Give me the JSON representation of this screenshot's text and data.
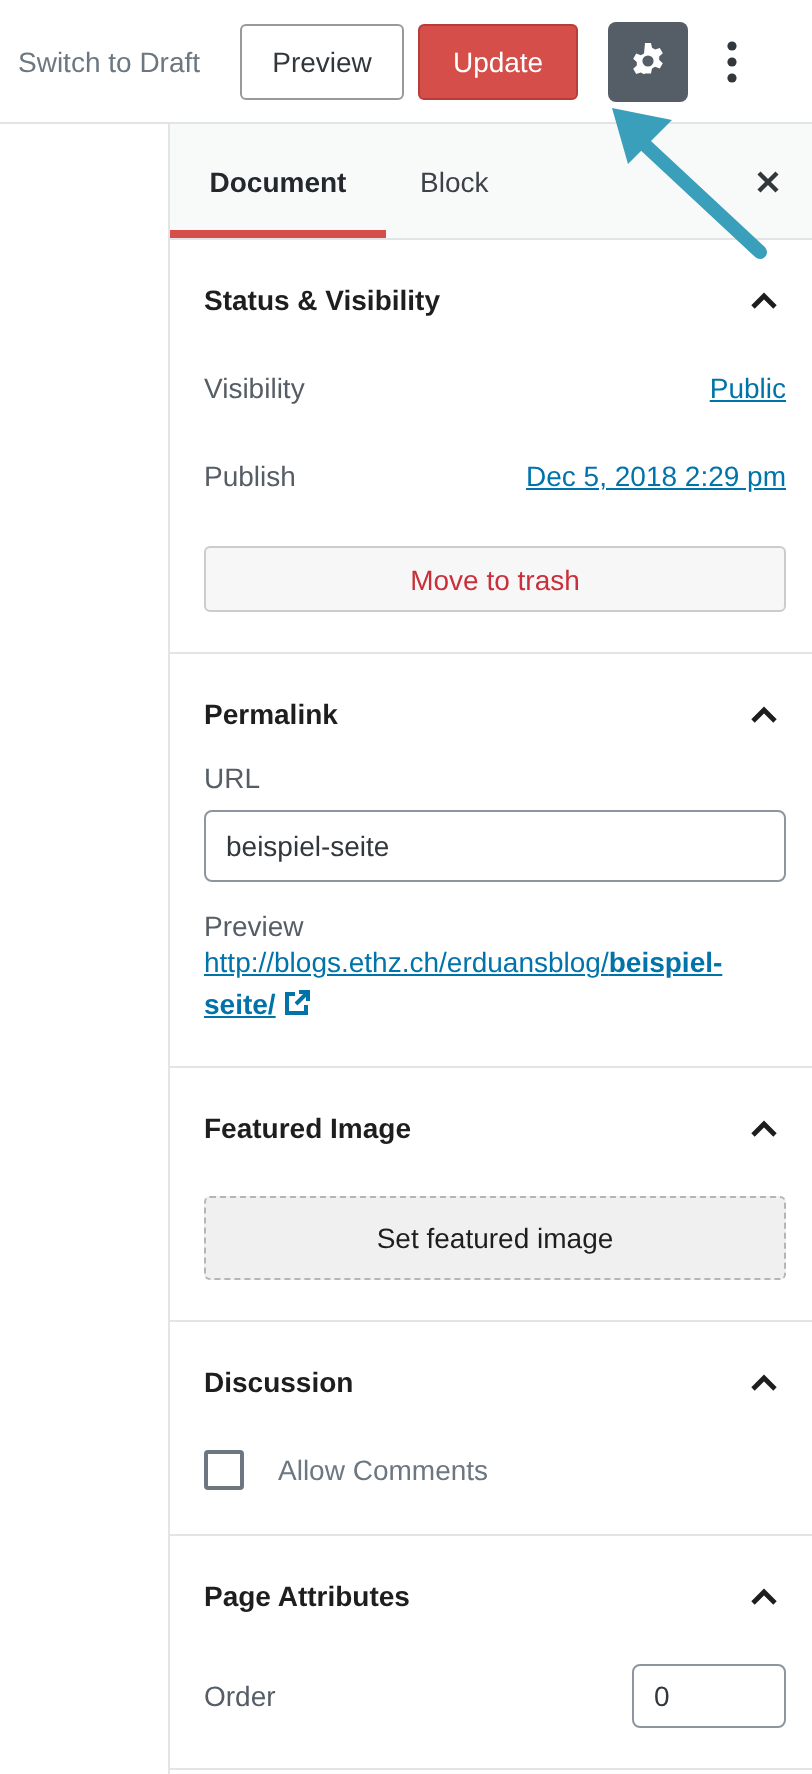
{
  "toolbar": {
    "switch_to_draft": "Switch to Draft",
    "preview_button": "Preview",
    "update_button": "Update",
    "settings_active": true
  },
  "tabs": [
    {
      "label": "Document",
      "selected": true
    },
    {
      "label": "Block",
      "selected": false
    }
  ],
  "panels": [
    {
      "kind": "status",
      "title": "Status & Visibility",
      "expanded": true,
      "rows": [
        {
          "label": "Visibility",
          "value": "Public"
        },
        {
          "label": "Publish",
          "value": "Dec 5, 2018 2:29 pm"
        }
      ],
      "button": "Move to trash"
    },
    {
      "kind": "permalink",
      "title": "Permalink",
      "expanded": true,
      "field_label": "URL",
      "value": "beispiel-seite",
      "preview_label": "Preview",
      "link": "http://blogs.ethz.ch/erduansblog/**beispiel-seite/**"
    },
    {
      "kind": "featured",
      "title": "Featured Image",
      "expanded": true,
      "button": "Set featured image"
    },
    {
      "kind": "discussion",
      "title": "Discussion",
      "expanded": true,
      "checkbox": {
        "label": "Allow Comments",
        "checked": false
      }
    },
    {
      "kind": "attributes",
      "title": "Page Attributes",
      "expanded": true,
      "field_label": "Order",
      "value": "0"
    }
  ]
}
